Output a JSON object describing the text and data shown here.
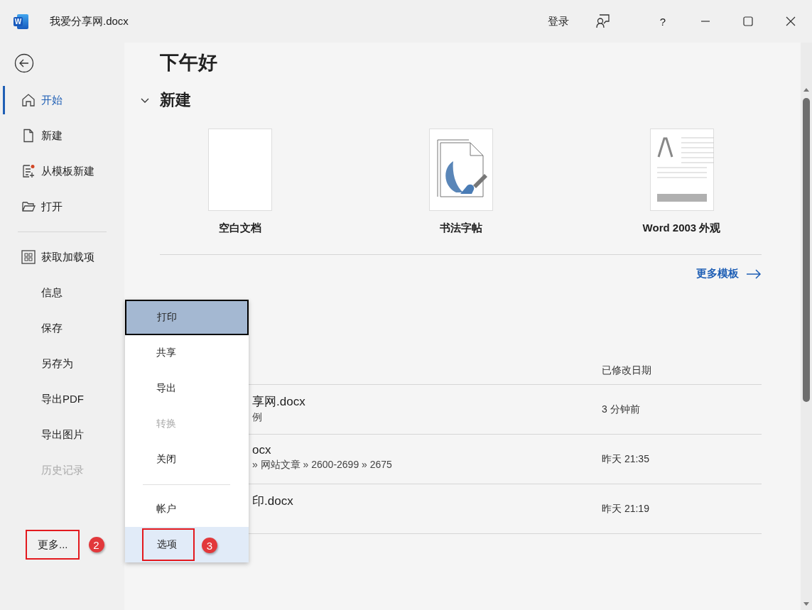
{
  "title_bar": {
    "app_icon_letter": "W",
    "document_title": "我爱分享网.docx",
    "sign_in": "登录",
    "help": "?"
  },
  "sidebar": {
    "items": [
      {
        "label": "开始",
        "selected": true,
        "disabled": false
      },
      {
        "label": "新建",
        "selected": false,
        "disabled": false
      },
      {
        "label": "从模板新建",
        "selected": false,
        "disabled": false
      },
      {
        "label": "打开",
        "selected": false,
        "disabled": false
      },
      {
        "label": "获取加载项",
        "selected": false,
        "disabled": false
      },
      {
        "label": "信息",
        "selected": false,
        "disabled": false
      },
      {
        "label": "保存",
        "selected": false,
        "disabled": false
      },
      {
        "label": "另存为",
        "selected": false,
        "disabled": false
      },
      {
        "label": "导出PDF",
        "selected": false,
        "disabled": false
      },
      {
        "label": "导出图片",
        "selected": false,
        "disabled": false
      },
      {
        "label": "历史记录",
        "selected": false,
        "disabled": true
      }
    ],
    "more": {
      "label": "更多...",
      "annotation": "2"
    }
  },
  "greeting": "下午好",
  "new_section": {
    "title": "新建",
    "expanded": true,
    "templates": [
      {
        "label": "空白文档"
      },
      {
        "label": "书法字帖"
      },
      {
        "label": "Word 2003 外观"
      }
    ],
    "more_templates": "更多模板"
  },
  "recent": {
    "columns": {
      "modified": "已修改日期"
    },
    "rows": [
      {
        "name": "享网.docx",
        "path": "例",
        "modified": "3 分钟前"
      },
      {
        "name": "ocx",
        "path": "» 网站文章 » 2600-2699 » 2675",
        "modified": "昨天 21:35"
      },
      {
        "name": "印.docx",
        "path": "",
        "modified": "昨天 21:19"
      }
    ]
  },
  "more_menu": {
    "items": [
      {
        "label": "打印",
        "selected": true,
        "hovered": false,
        "disabled": false,
        "divider_before": false
      },
      {
        "label": "共享",
        "selected": false,
        "hovered": false,
        "disabled": false,
        "divider_before": false
      },
      {
        "label": "导出",
        "selected": false,
        "hovered": false,
        "disabled": false,
        "divider_before": false
      },
      {
        "label": "转换",
        "selected": false,
        "hovered": false,
        "disabled": true,
        "divider_before": false
      },
      {
        "label": "关闭",
        "selected": false,
        "hovered": false,
        "disabled": false,
        "divider_before": false
      },
      {
        "label": "帐户",
        "selected": false,
        "hovered": false,
        "disabled": false,
        "divider_before": true
      },
      {
        "label": "选项",
        "selected": false,
        "hovered": true,
        "disabled": false,
        "divider_before": false,
        "annotation": "3"
      }
    ]
  }
}
